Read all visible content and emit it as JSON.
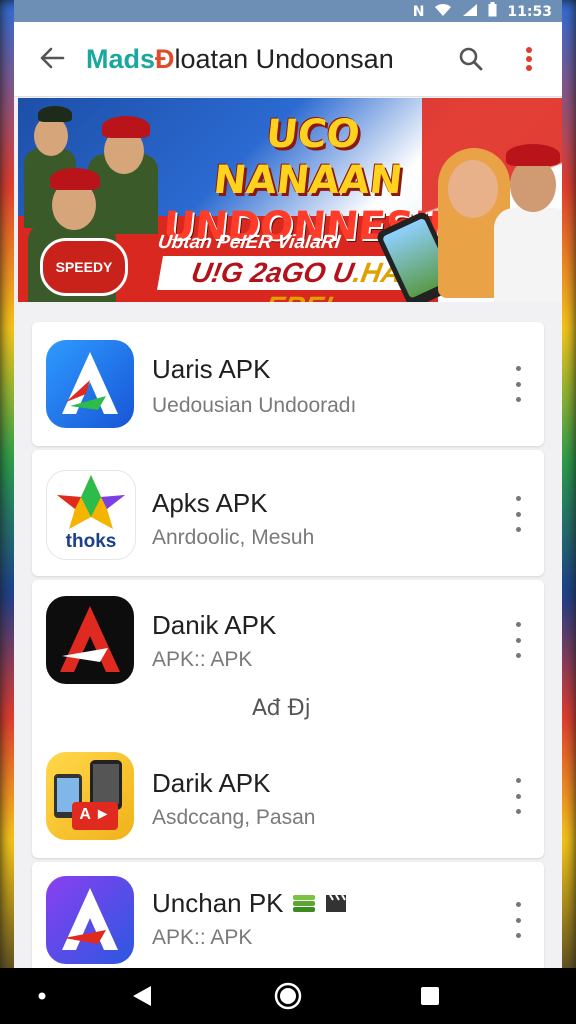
{
  "status_bar": {
    "time": "11:53",
    "icons": [
      "nfc-icon",
      "wifi-icon",
      "signal-icon",
      "battery-icon"
    ],
    "nfc_label": "N"
  },
  "app_bar": {
    "title_part1": "Mads",
    "title_part2": "Đ",
    "title_rest": "loatan Undoonsan",
    "back_icon": "arrow-back-icon",
    "search_icon": "search-icon",
    "more_icon": "more-vert-icon",
    "accent": "#e03c2e"
  },
  "banner": {
    "headline_line1": "UCO NANAAN",
    "headline_line2": "UNDONNESIN",
    "sub_line1": "Ubtan PeIER ViaIaRI",
    "sub_line2_a": "U!G 2aGO U",
    "sub_line2_b": ".HAY ERE!",
    "seal_text": "SPEEDY"
  },
  "apps": [
    {
      "name": "Uaris APK",
      "desc": "Uedousian Undooradı",
      "icon": "a-logo-blue-icon"
    },
    {
      "name": "Apks APK",
      "desc": "Anrdoolic, Mesuh",
      "icon": "star-thoks-icon",
      "icon_text": "thoks"
    },
    {
      "name": "Danik APK",
      "desc": "APK:: APK",
      "icon": "a-logo-black-icon"
    },
    {
      "name": "Darik APK",
      "desc": "Asdccang, Pasan",
      "icon": "phones-yellow-icon",
      "icon_text": "A ►"
    },
    {
      "name": "Unchan PK",
      "desc": "APK:: APK",
      "icon": "a-logo-purple-icon",
      "badge_icons": [
        "stack-icon",
        "clapper-icon"
      ]
    }
  ],
  "section_label": "Ađ Đj",
  "nav_bar": {
    "icons": [
      "dot-icon",
      "back-triangle-icon",
      "home-circle-icon",
      "recents-square-icon"
    ]
  }
}
